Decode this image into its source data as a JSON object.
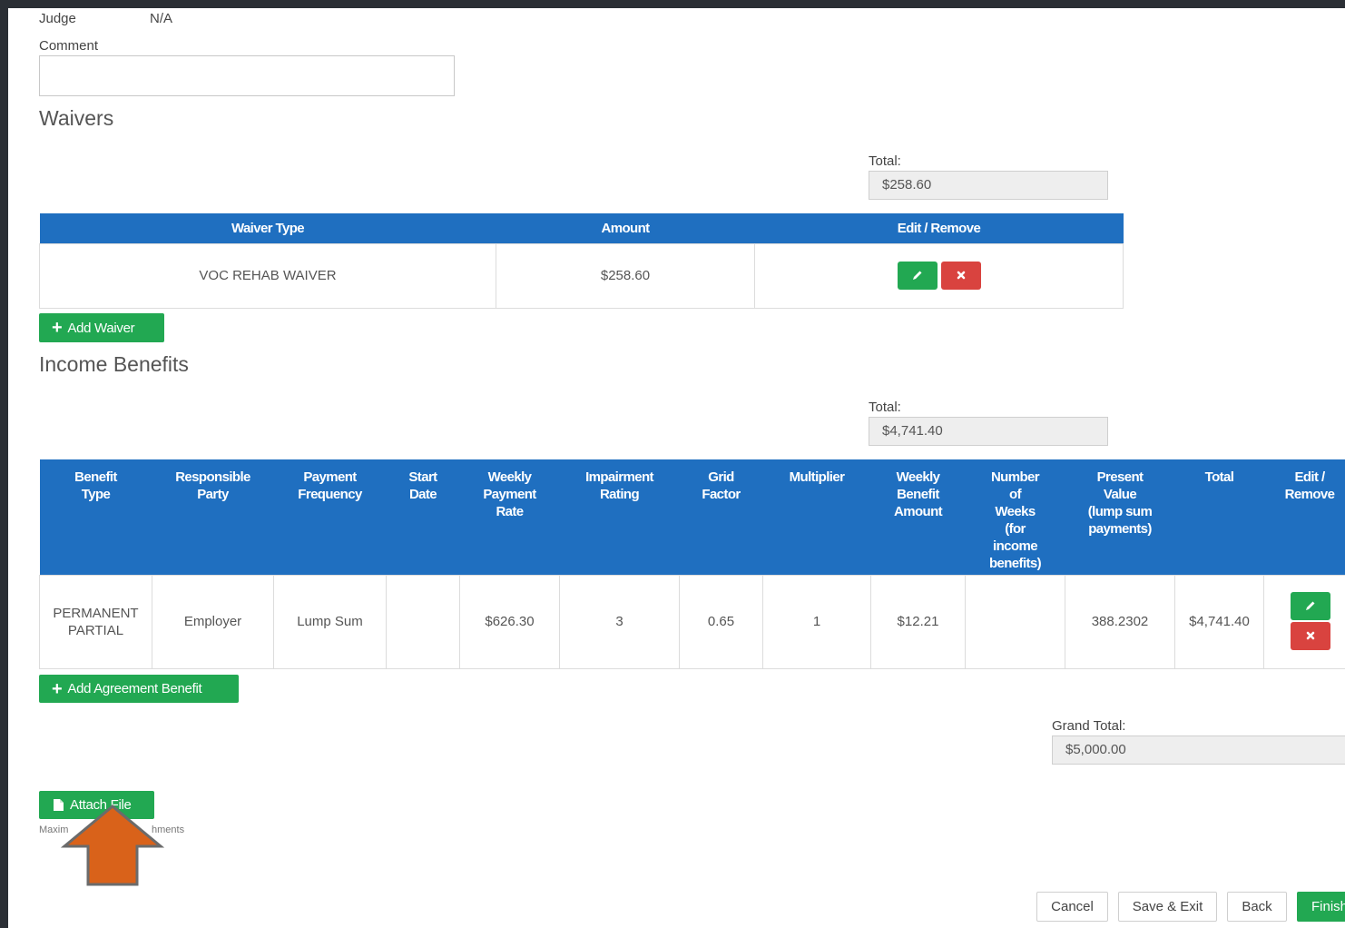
{
  "judge": {
    "label": "Judge",
    "value": "N/A"
  },
  "comment": {
    "label": "Comment",
    "value": ""
  },
  "waivers": {
    "title": "Waivers",
    "total_label": "Total:",
    "total_value": "$258.60",
    "headers": [
      "Waiver Type",
      "Amount",
      "Edit / Remove"
    ],
    "rows": [
      {
        "waiver_type": "VOC REHAB WAIVER",
        "amount": "$258.60"
      }
    ],
    "add_button": "Add Waiver"
  },
  "income_benefits": {
    "title": "Income Benefits",
    "total_label": "Total:",
    "total_value": "$4,741.40",
    "headers": {
      "benefit_type": [
        "Benefit",
        "Type"
      ],
      "responsible_party": [
        "Responsible",
        "Party"
      ],
      "payment_frequency": [
        "Payment",
        "Frequency"
      ],
      "start_date": [
        "Start",
        "Date"
      ],
      "weekly_payment_rate": [
        "Weekly",
        "Payment",
        "Rate"
      ],
      "impairment_rating": [
        "Impairment",
        "Rating"
      ],
      "grid_factor": [
        "Grid",
        "Factor"
      ],
      "multiplier": [
        "Multiplier"
      ],
      "weekly_benefit_amount": [
        "Weekly",
        "Benefit",
        "Amount"
      ],
      "number_of_weeks": [
        "Number",
        "of",
        "Weeks",
        "(for",
        "income",
        "benefits)"
      ],
      "present_value": [
        "Present",
        "Value",
        "(lump sum",
        "payments)"
      ],
      "total": [
        "Total"
      ],
      "edit_remove": [
        "Edit /",
        "Remove"
      ]
    },
    "rows": [
      {
        "benefit_type": [
          "PERMANENT",
          "PARTIAL"
        ],
        "responsible_party": "Employer",
        "payment_frequency": "Lump Sum",
        "start_date": "",
        "weekly_payment_rate": "$626.30",
        "impairment_rating": "3",
        "grid_factor": "0.65",
        "multiplier": "1",
        "weekly_benefit_amount": "$12.21",
        "number_of_weeks": "",
        "present_value": "388.2302",
        "total": "$4,741.40"
      }
    ],
    "add_button": "Add Agreement Benefit"
  },
  "grand_total": {
    "label": "Grand Total:",
    "value": "$5,000.00"
  },
  "attach": {
    "button": "Attach File",
    "note_left": "Maxim",
    "note_right": "hments"
  },
  "footer": {
    "cancel": "Cancel",
    "save_exit": "Save & Exit",
    "back": "Back",
    "finish": "Finish"
  },
  "colors": {
    "header_blue": "#1f6fc0",
    "green": "#22a852",
    "red": "#d9433f",
    "arrow": "#d9621a"
  },
  "icons": {
    "edit": "pencil-icon",
    "remove": "x-icon",
    "add": "plus-icon",
    "attach": "file-icon",
    "pointer": "up-arrow-icon"
  }
}
